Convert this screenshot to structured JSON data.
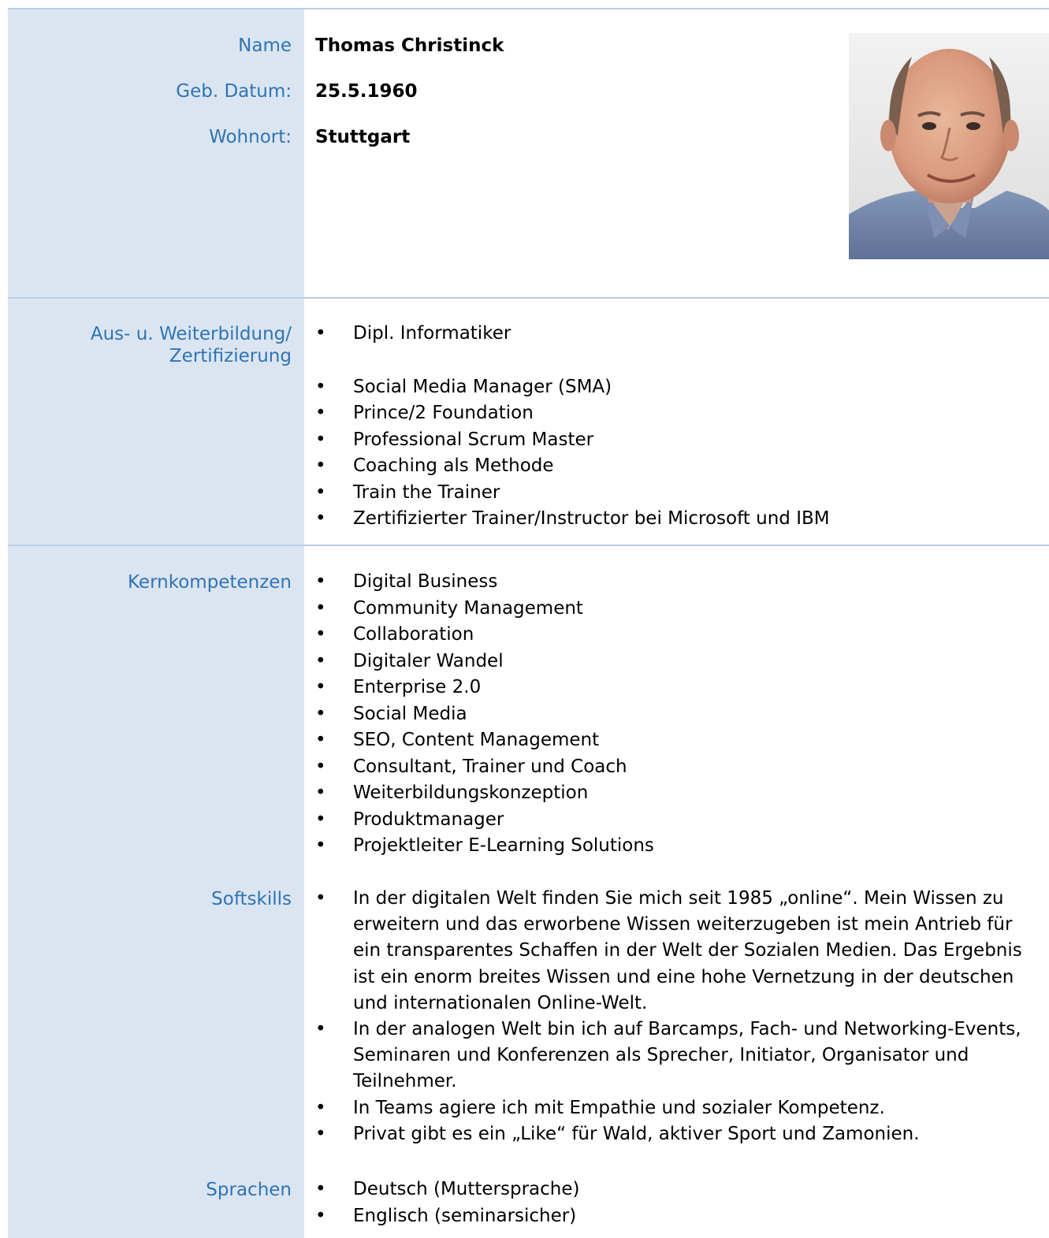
{
  "personal": {
    "name_label": "Name",
    "name_value": "Thomas Christinck",
    "birth_label": "Geb. Datum:",
    "birth_value": "25.5.1960",
    "residence_label": "Wohnort:",
    "residence_value": "Stuttgart"
  },
  "education": {
    "label_line1": "Aus- u. Weiterbildung/",
    "label_line2": "Zertifizierung",
    "items": [
      "Dipl. Informatiker",
      "Social Media Manager (SMA)",
      "Prince/2 Foundation",
      "Professional Scrum Master",
      "Coaching als Methode",
      "Train the Trainer",
      "Zertifizierter Trainer/Instructor bei Microsoft und IBM"
    ]
  },
  "core": {
    "label": "Kernkompetenzen",
    "items": [
      "Digital Business",
      "Community Management",
      "Collaboration",
      "Digitaler Wandel",
      "Enterprise 2.0",
      "Social Media",
      "SEO, Content Management",
      "Consultant, Trainer und Coach",
      "Weiterbildungskonzeption",
      "Produktmanager",
      "Projektleiter E-Learning Solutions"
    ]
  },
  "softskills": {
    "label": "Softskills",
    "items": [
      "In der digitalen Welt finden Sie mich seit 1985 „online“. Mein Wissen zu erweitern und das erworbene Wissen weiterzugeben ist mein Antrieb für ein transparentes Schaffen in der Welt der Sozialen Medien. Das Ergebnis ist ein enorm breites Wissen und eine hohe Vernetzung in der deutschen und internationalen Online-Welt.",
      "In der analogen Welt bin ich auf Barcamps, Fach- und Networking-Events, Seminaren und Konferenzen als Sprecher, Initiator, Organisator und Teilnehmer.",
      "In Teams agiere ich mit Empathie und sozialer Kompetenz.",
      "Privat gibt es ein „Like“ für Wald, aktiver Sport und Zamonien."
    ]
  },
  "languages": {
    "label": "Sprachen",
    "items": [
      "Deutsch (Muttersprache)",
      "Englisch (seminarsicher)"
    ]
  },
  "colors": {
    "label_blue": "#2e74b5",
    "sidebar_bg": "#dbe5f1",
    "divider": "#b8cce4"
  }
}
